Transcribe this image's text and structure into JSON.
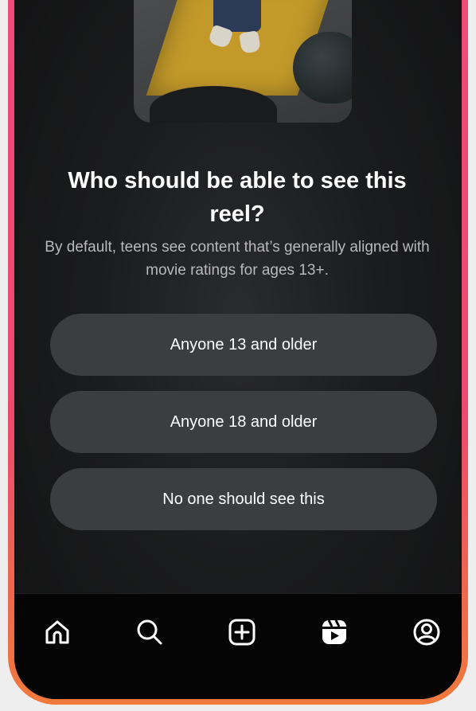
{
  "dialog": {
    "title": "Who should be able to see this reel?",
    "subtitle": "By default, teens see content that’s generally aligned with movie ratings for ages 13+.",
    "options": [
      {
        "label": "Anyone 13 and older"
      },
      {
        "label": "Anyone 18 and older"
      },
      {
        "label": "No one should see this"
      }
    ]
  },
  "navbar": {
    "items": [
      {
        "icon": "home-icon"
      },
      {
        "icon": "search-icon"
      },
      {
        "icon": "create-icon"
      },
      {
        "icon": "reels-icon"
      },
      {
        "icon": "profile-icon"
      }
    ]
  },
  "colors": {
    "frame_gradient_top": "#f04a7a",
    "frame_gradient_bottom": "#f07a3c",
    "option_background": "#3c3d3f",
    "navbar_background": "#050505"
  }
}
